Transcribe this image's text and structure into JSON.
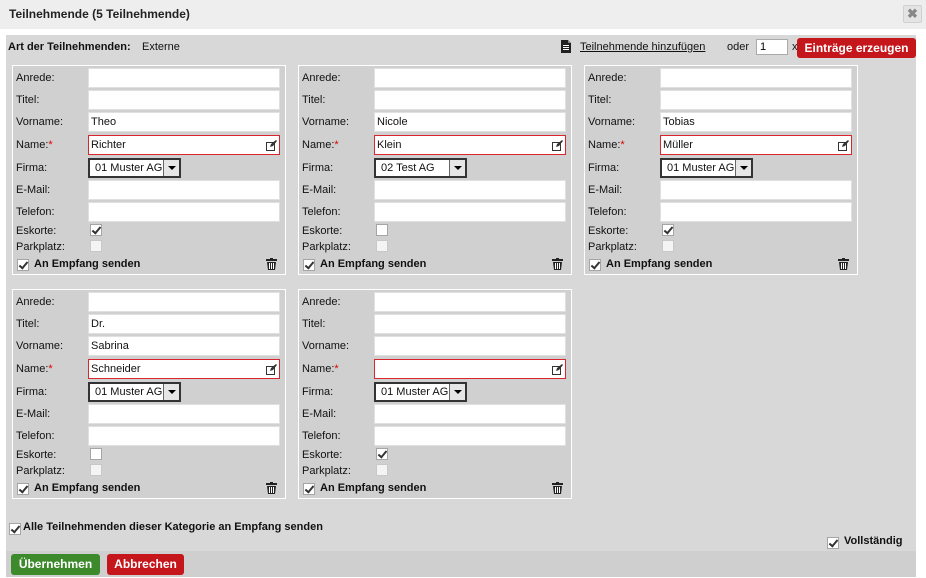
{
  "dialog": {
    "title": "Teilnehmende (5 Teilnehmende)",
    "close_icon": "close-icon"
  },
  "category": {
    "label": "Art der Teilnehmenden:",
    "value": "Externe"
  },
  "add": {
    "link": "Teilnehmende hinzufügen",
    "or": "oder",
    "count": "1",
    "x": "x",
    "create_button": "Einträge erzeugen"
  },
  "field_labels": {
    "anrede": "Anrede:",
    "titel": "Titel:",
    "vorname": "Vorname:",
    "name": "Name:",
    "required": "*",
    "firma": "Firma:",
    "email": "E-Mail:",
    "telefon": "Telefon:",
    "eskorte": "Eskorte:",
    "parkplatz": "Parkplatz:",
    "send": "An Empfang senden"
  },
  "participants": [
    {
      "anrede": "",
      "titel": "",
      "vorname": "Theo",
      "name": "Richter",
      "firma": "01 Muster AG",
      "email": "",
      "telefon": "",
      "eskorte": true,
      "parkplatz": false,
      "send": true
    },
    {
      "anrede": "",
      "titel": "",
      "vorname": "Nicole",
      "name": "Klein",
      "firma": "02 Test AG",
      "email": "",
      "telefon": "",
      "eskorte": false,
      "parkplatz": false,
      "send": true
    },
    {
      "anrede": "",
      "titel": "",
      "vorname": "Tobias",
      "name": "Müller",
      "firma": "01 Muster AG",
      "email": "",
      "telefon": "",
      "eskorte": true,
      "parkplatz": false,
      "send": true
    },
    {
      "anrede": "",
      "titel": "Dr.",
      "vorname": "Sabrina",
      "name": "Schneider",
      "firma": "01 Muster AG",
      "email": "",
      "telefon": "",
      "eskorte": false,
      "parkplatz": false,
      "send": true
    },
    {
      "anrede": "",
      "titel": "",
      "vorname": "",
      "name": "",
      "firma": "01 Muster AG",
      "email": "",
      "telefon": "",
      "eskorte": true,
      "parkplatz": false,
      "send": true
    }
  ],
  "footer": {
    "send_all_label": "Alle Teilnehmenden dieser Kategorie an Empfang senden",
    "send_all_checked": true,
    "complete_label": "Vollständig",
    "complete_checked": true,
    "apply_button": "Übernehmen",
    "cancel_button": "Abbrechen"
  },
  "colors": {
    "primary_red": "#c5161b",
    "apply_green": "#3d8a2c",
    "panel_gray": "#d8d8d8"
  }
}
